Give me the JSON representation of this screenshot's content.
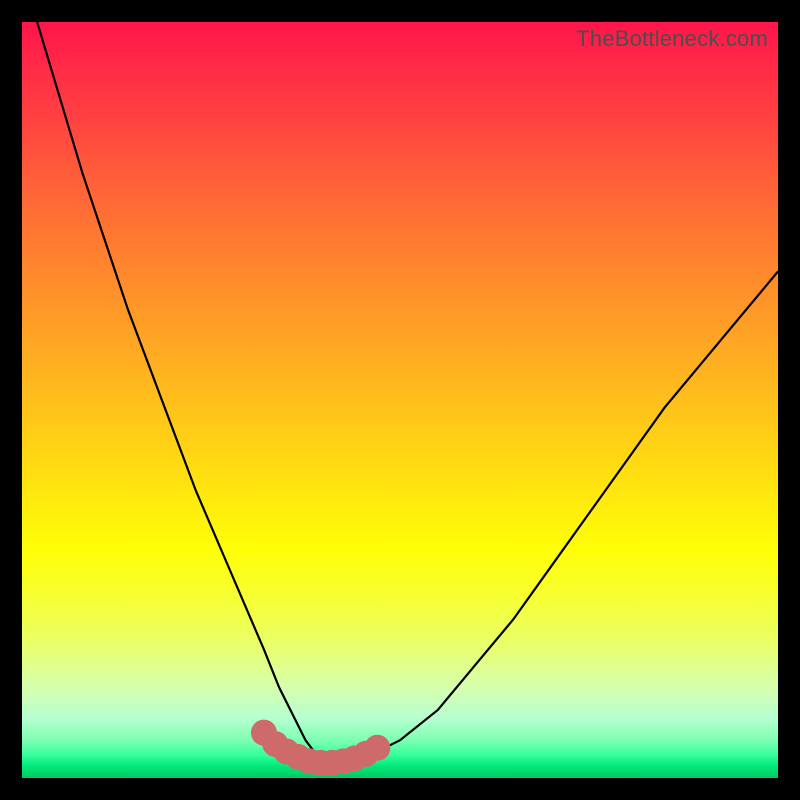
{
  "watermark": "TheBottleneck.com",
  "colors": {
    "frame": "#000000",
    "curve_stroke": "#000000",
    "highlight_stroke": "#cf6a6b"
  },
  "chart_data": {
    "type": "line",
    "title": "",
    "xlabel": "",
    "ylabel": "",
    "xlim": [
      0,
      100
    ],
    "ylim": [
      0,
      100
    ],
    "series": [
      {
        "name": "bottleneck-curve",
        "x": [
          2,
          5,
          8,
          11,
          14,
          17,
          20,
          23,
          26,
          29,
          32,
          34,
          36,
          37.5,
          39,
          40.5,
          42,
          44,
          46,
          50,
          55,
          60,
          65,
          70,
          75,
          80,
          85,
          90,
          95,
          100
        ],
        "values": [
          100,
          90,
          80,
          71,
          62,
          54,
          46,
          38,
          31,
          24,
          17,
          12,
          8,
          5,
          3,
          2,
          2,
          2,
          3,
          5,
          9,
          15,
          21,
          28,
          35,
          42,
          49,
          55,
          61,
          67
        ]
      },
      {
        "name": "highlight-segment",
        "x": [
          32,
          33.5,
          35,
          36.5,
          38,
          39.5,
          41,
          42.5,
          44,
          45.5,
          47
        ],
        "values": [
          6,
          4.5,
          3.5,
          2.8,
          2.2,
          2.0,
          2.0,
          2.2,
          2.6,
          3.2,
          4
        ]
      }
    ]
  }
}
